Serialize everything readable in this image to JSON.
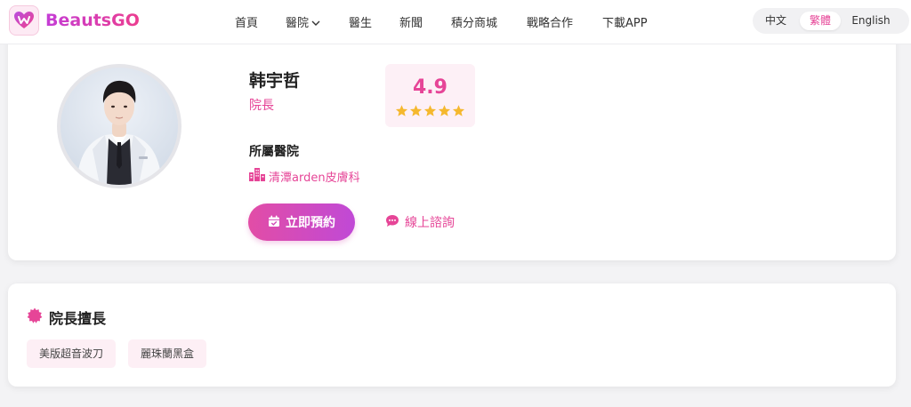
{
  "header": {
    "logo_text": "BeautsGO",
    "nav": [
      {
        "label": "首頁"
      },
      {
        "label": "醫院"
      },
      {
        "label": "醫生"
      },
      {
        "label": "新聞"
      },
      {
        "label": "積分商城"
      },
      {
        "label": "戰略合作"
      },
      {
        "label": "下載APP"
      }
    ],
    "languages": [
      "中文",
      "繁體",
      "English"
    ],
    "active_language": "繁體"
  },
  "doctor": {
    "name": "韩宇哲",
    "title": "院長",
    "rating": "4.9",
    "stars": 5,
    "hospital_label": "所屬醫院",
    "hospital_name": "清潭arden皮膚科",
    "book_label": "立即預約",
    "consult_label": "線上諮詢"
  },
  "specialties": {
    "heading": "院長擅長",
    "tags": [
      "美版超音波刀",
      "麗珠蘭黑盒"
    ]
  },
  "colors": {
    "brand_pink": "#e64597",
    "brand_purple": "#c049d6",
    "star": "#f5b82e",
    "tag_bg": "#fdeff5"
  }
}
